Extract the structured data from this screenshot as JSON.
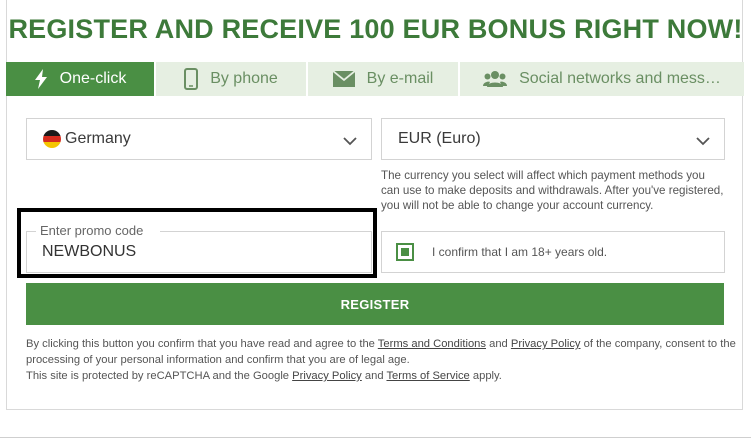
{
  "headline": "REGISTER AND RECEIVE 100 EUR BONUS RIGHT NOW!",
  "tabs": [
    {
      "label": "One-click",
      "icon": "lightning-icon",
      "active": true
    },
    {
      "label": "By phone",
      "icon": "phone-icon",
      "active": false
    },
    {
      "label": "By e-mail",
      "icon": "envelope-icon",
      "active": false
    },
    {
      "label": "Social networks and mess…",
      "icon": "users-icon",
      "active": false
    }
  ],
  "country": {
    "value": "Germany",
    "icon": "germany-flag-icon"
  },
  "currency": {
    "value": "EUR (Euro)"
  },
  "currency_note": "The currency you select will affect which payment methods you can use to make deposits and withdrawals. After you've registered, you will not be able to change your account currency.",
  "promo": {
    "label": "Enter promo code",
    "value": "NEWBONUS"
  },
  "age_confirm": {
    "label": "I confirm that I am 18+ years old.",
    "checked": true
  },
  "register_button": "REGISTER",
  "legal": {
    "part1": "By clicking this button you confirm that you have read and agree to the ",
    "terms_link": "Terms and Conditions",
    "part2": " and ",
    "privacy_link": "Privacy Policy",
    "part3": " of the company, consent to the processing of your personal information and confirm that you are of legal age.",
    "part4": "This site is protected by reCAPTCHA and the Google ",
    "google_privacy_link": "Privacy Policy",
    "part5": " and ",
    "tos_link": "Terms of Service",
    "part6": " apply."
  },
  "colors": {
    "brand_green": "#4a8f44",
    "headline_green": "#3d7a3a",
    "tab_inactive_bg": "#e6efe2"
  }
}
